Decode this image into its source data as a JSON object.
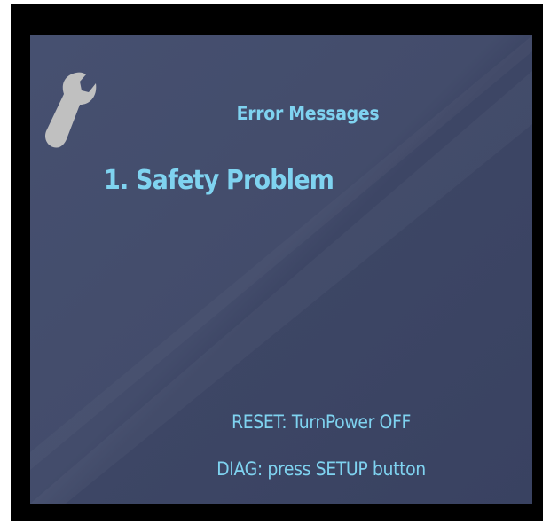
{
  "screen": {
    "icon": "wrench-icon",
    "title": "Error Messages",
    "error_item": "1. Safety Problem",
    "reset_hint": "RESET: TurnPower OFF",
    "diag_hint": "DIAG: press SETUP button"
  },
  "colors": {
    "bezel": "#000000",
    "panel": "#434c6b",
    "text": "#7fd3f0",
    "icon": "#c0c0c0"
  }
}
